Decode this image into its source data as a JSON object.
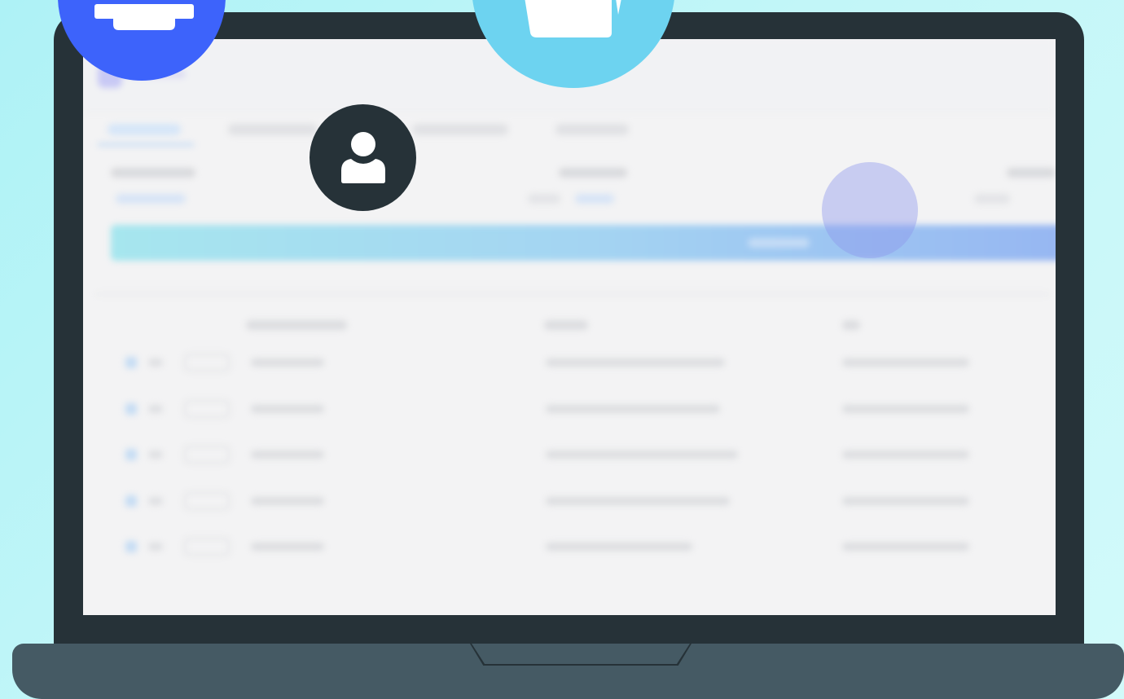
{
  "colors": {
    "background": "#b3f4f8",
    "laptop_frame": "#263238",
    "laptop_base": "#455a64",
    "screen": "#f3f3f4",
    "badge_blue": "#3d63fb",
    "badge_cyan": "#6dd3f0",
    "badge_dark": "#263238",
    "banner_gradient_start": "#a6e6ee",
    "banner_gradient_end": "#96b6f2"
  },
  "icons": {
    "blue_badge": "printer-icon",
    "cyan_badge": "document-icon",
    "dark_badge": "user-icon"
  },
  "table": {
    "row_count": 5
  }
}
